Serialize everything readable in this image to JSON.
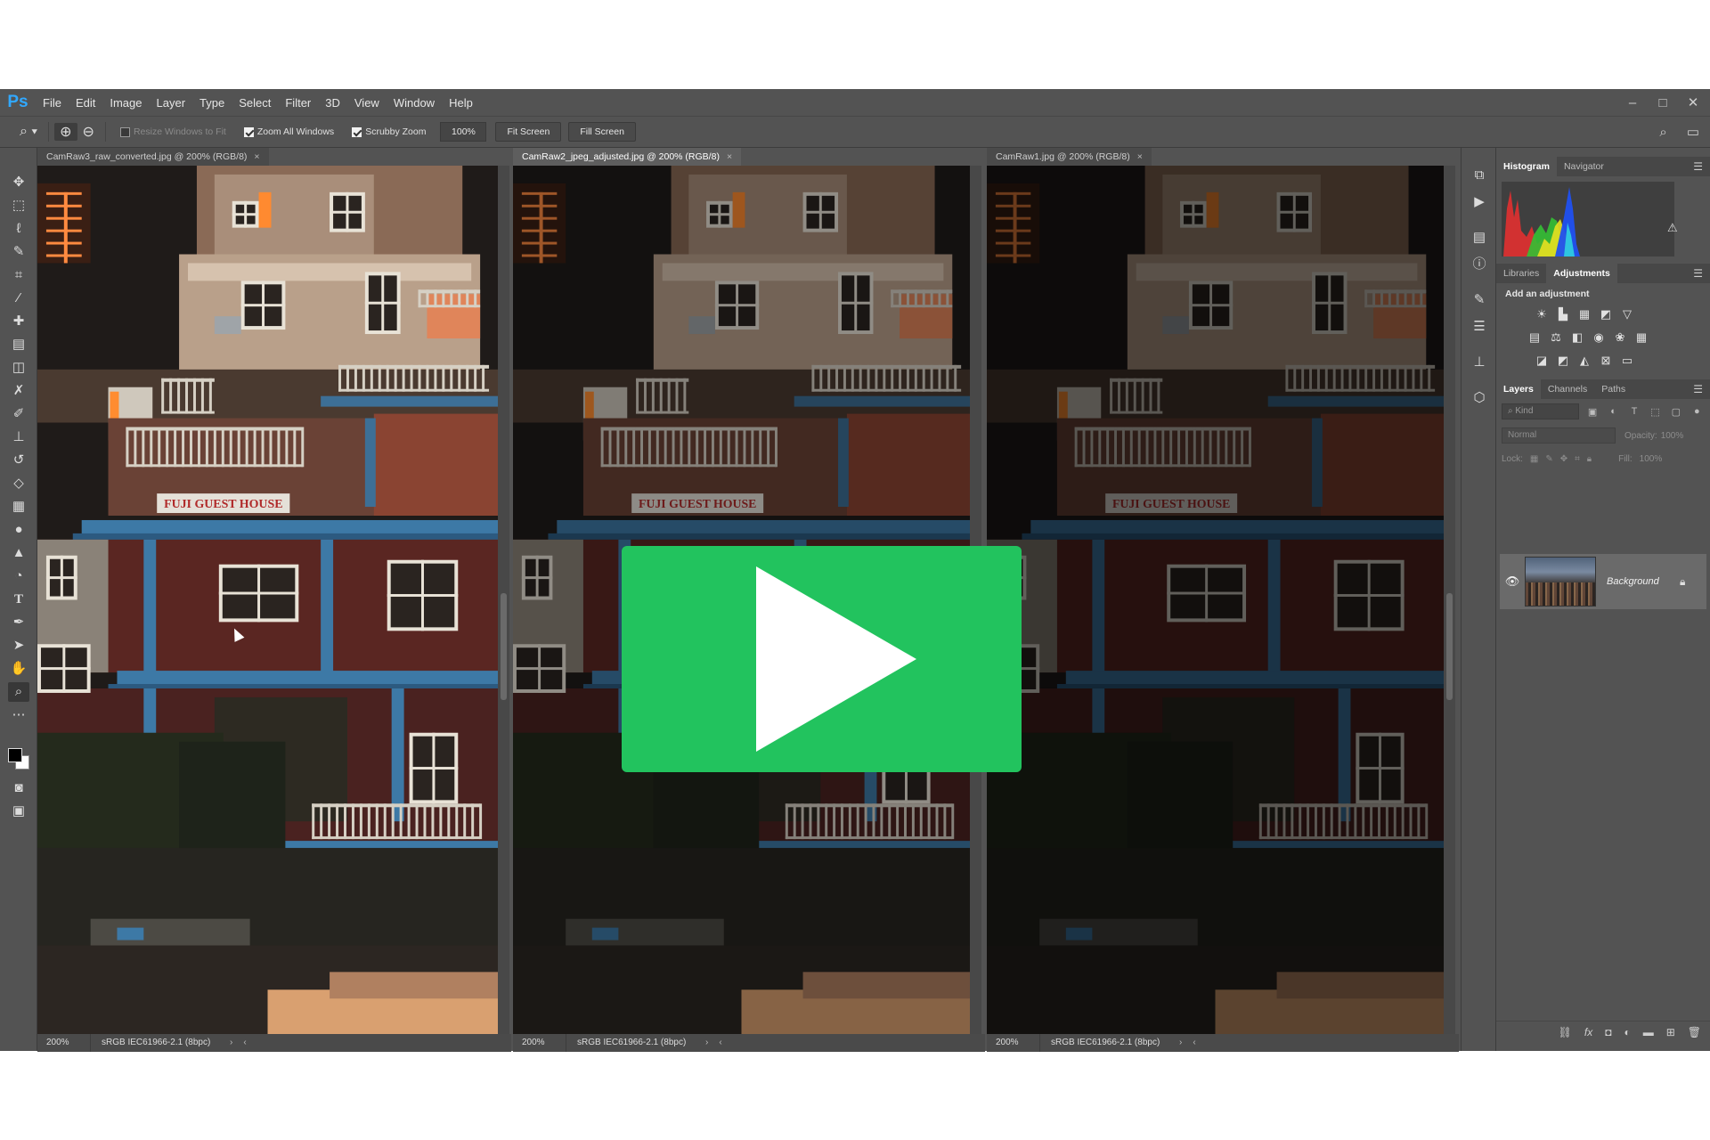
{
  "app": {
    "logo": "Ps",
    "menu": [
      "File",
      "Edit",
      "Image",
      "Layer",
      "Type",
      "Select",
      "Filter",
      "3D",
      "View",
      "Window",
      "Help"
    ]
  },
  "options_bar": {
    "resize_windows": "Resize Windows to Fit",
    "zoom_all_windows": "Zoom All Windows",
    "scrubby_zoom": "Scrubby Zoom",
    "zoom_value": "100%",
    "fit_screen": "Fit Screen",
    "fill_screen": "Fill Screen"
  },
  "documents": [
    {
      "tab": "CamRaw3_raw_converted.jpg @ 200% (RGB/8)",
      "zoom": "200%",
      "profile": "sRGB IEC61966-2.1 (8bpc)",
      "brightness": 1.0
    },
    {
      "tab": "CamRaw2_jpeg_adjusted.jpg @ 200% (RGB/8)",
      "zoom": "200%",
      "profile": "sRGB IEC61966-2.1 (8bpc)",
      "brightness": 0.62
    },
    {
      "tab": "CamRaw1.jpg @ 200% (RGB/8)",
      "zoom": "200%",
      "profile": "sRGB IEC61966-2.1 (8bpc)",
      "brightness": 0.42
    }
  ],
  "image_content": {
    "sign_text": "FUJI GUEST HOUSE"
  },
  "panels": {
    "histogram_tab": "Histogram",
    "navigator_tab": "Navigator",
    "libraries_tab": "Libraries",
    "adjustments_tab": "Adjustments",
    "add_adjustment": "Add an adjustment",
    "layers_tab": "Layers",
    "channels_tab": "Channels",
    "paths_tab": "Paths",
    "kind_placeholder": "Kind",
    "blend_mode": "Normal",
    "opacity_label": "Opacity:",
    "opacity_value": "100%",
    "lock_label": "Lock:",
    "fill_label": "Fill:",
    "fill_value": "100%",
    "layer_name": "Background"
  },
  "colors": {
    "ui_bg": "#535353",
    "play_green": "#22c35e",
    "ps_blue": "#31a8ff"
  },
  "icons": {
    "play": "play-icon"
  }
}
